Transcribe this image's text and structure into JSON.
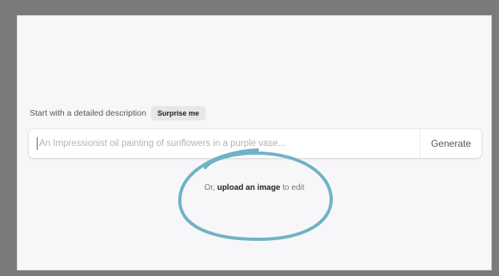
{
  "prompt": {
    "label": "Start with a detailed description",
    "surprise_label": "Surprise me"
  },
  "input": {
    "placeholder": "An Impressionist oil painting of sunflowers in a purple vase...",
    "value": ""
  },
  "generate_label": "Generate",
  "upload": {
    "prefix": "Or,",
    "link_text": "upload an image",
    "suffix": "to edit"
  },
  "colors": {
    "annotation_circle": "#6fb3c4",
    "frame": "#7a7a7a",
    "background": "#f7f7fa"
  }
}
